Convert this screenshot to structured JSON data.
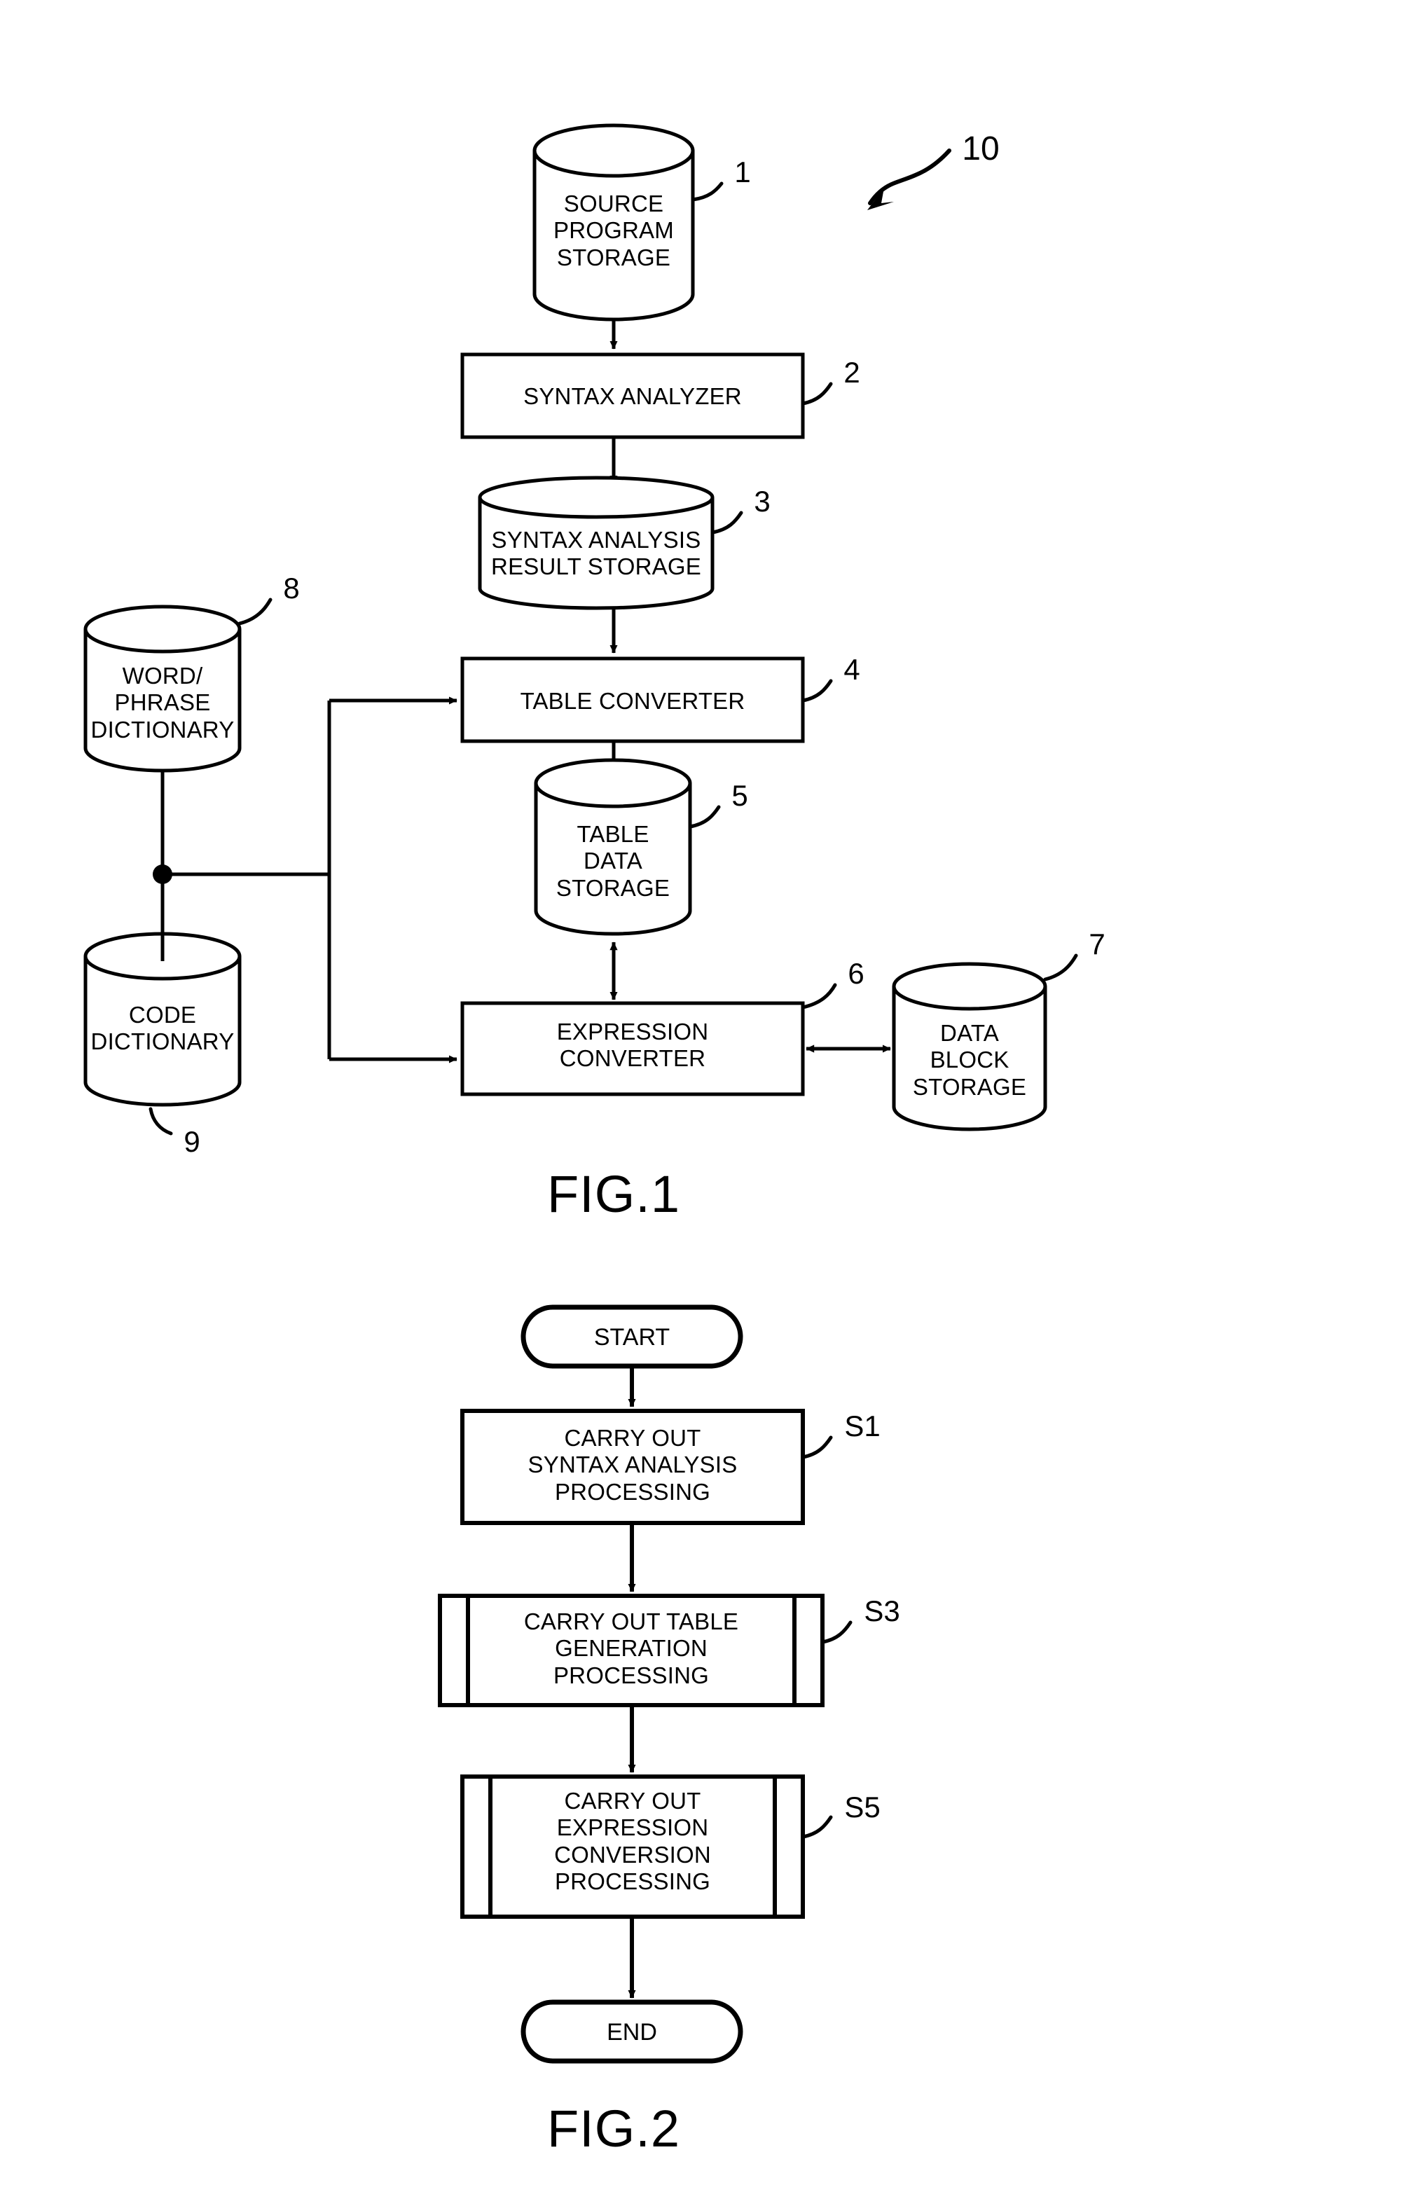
{
  "figure1": {
    "caption": "FIG.1",
    "system_ref": "10",
    "nodes": [
      {
        "id": "source-program-storage",
        "shape": "cylinder",
        "label": "SOURCE\nPROGRAM\nSTORAGE",
        "ref": "1"
      },
      {
        "id": "syntax-analyzer",
        "shape": "rect",
        "label": "SYNTAX ANALYZER",
        "ref": "2"
      },
      {
        "id": "syntax-analysis-result-storage",
        "shape": "cylinder",
        "label": "SYNTAX ANALYSIS\nRESULT STORAGE",
        "ref": "3"
      },
      {
        "id": "table-converter",
        "shape": "rect",
        "label": "TABLE CONVERTER",
        "ref": "4"
      },
      {
        "id": "table-data-storage",
        "shape": "cylinder",
        "label": "TABLE\nDATA\nSTORAGE",
        "ref": "5"
      },
      {
        "id": "expression-converter",
        "shape": "rect",
        "label": "EXPRESSION\nCONVERTER",
        "ref": "6"
      },
      {
        "id": "data-block-storage",
        "shape": "cylinder",
        "label": "DATA\nBLOCK\nSTORAGE",
        "ref": "7"
      },
      {
        "id": "word-phrase-dictionary",
        "shape": "cylinder",
        "label": "WORD/\nPHRASE\nDICTIONARY",
        "ref": "8"
      },
      {
        "id": "code-dictionary",
        "shape": "cylinder",
        "label": "CODE\nDICTIONARY",
        "ref": "9"
      }
    ],
    "edges": [
      {
        "from": "source-program-storage",
        "to": "syntax-analyzer",
        "type": "arrow"
      },
      {
        "from": "syntax-analyzer",
        "to": "syntax-analysis-result-storage",
        "type": "arrow"
      },
      {
        "from": "syntax-analysis-result-storage",
        "to": "table-converter",
        "type": "arrow"
      },
      {
        "from": "table-converter",
        "to": "table-data-storage",
        "type": "arrow"
      },
      {
        "from": "table-data-storage",
        "to": "expression-converter",
        "type": "double-arrow"
      },
      {
        "from": "expression-converter",
        "to": "data-block-storage",
        "type": "double-arrow"
      },
      {
        "from": "word-phrase-dictionary",
        "to": "table-converter",
        "type": "arrow"
      },
      {
        "from": "code-dictionary",
        "to": "expression-converter",
        "type": "arrow"
      }
    ]
  },
  "figure2": {
    "caption": "FIG.2",
    "nodes": [
      {
        "id": "start",
        "shape": "terminator",
        "label": "START",
        "ref": ""
      },
      {
        "id": "step-s1",
        "shape": "process",
        "label": "CARRY OUT\nSYNTAX ANALYSIS\nPROCESSING",
        "ref": "S1"
      },
      {
        "id": "step-s3",
        "shape": "predefined-process",
        "label": "CARRY OUT TABLE\nGENERATION\nPROCESSING",
        "ref": "S3"
      },
      {
        "id": "step-s5",
        "shape": "predefined-process",
        "label": "CARRY OUT\nEXPRESSION\nCONVERSION\nPROCESSING",
        "ref": "S5"
      },
      {
        "id": "end",
        "shape": "terminator",
        "label": "END",
        "ref": ""
      }
    ],
    "edges": [
      {
        "from": "start",
        "to": "step-s1",
        "type": "arrow"
      },
      {
        "from": "step-s1",
        "to": "step-s3",
        "type": "arrow"
      },
      {
        "from": "step-s3",
        "to": "step-s5",
        "type": "arrow"
      },
      {
        "from": "step-s5",
        "to": "end",
        "type": "arrow"
      }
    ]
  },
  "colors": {
    "ink": "#000000",
    "paper": "#ffffff"
  }
}
